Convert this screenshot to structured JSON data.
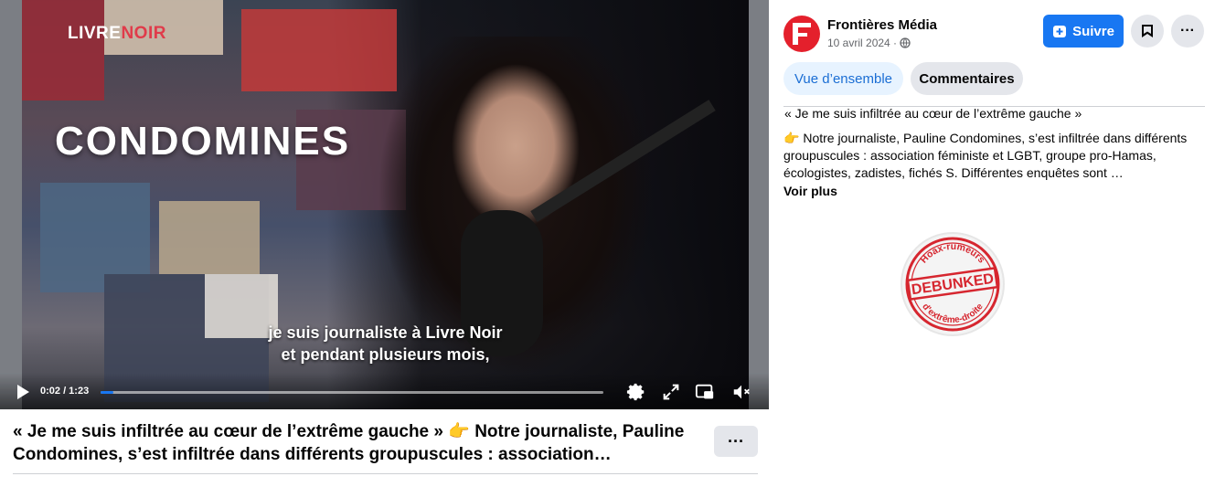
{
  "video": {
    "brand_left": "LIVRE",
    "brand_right": "NOIR",
    "overlay_name": "CONDOMINES",
    "subtitle_line1": "je suis journaliste à Livre Noir",
    "subtitle_line2": "et pendant plusieurs mois,",
    "time": "0:02 / 1:23",
    "progress_fraction": 0.025,
    "controls": {
      "play_icon": "play-icon",
      "settings_icon": "gear-icon",
      "fullscreen_icon": "expand-icon",
      "pip_icon": "picture-in-picture-icon",
      "volume_icon": "volume-muted-icon"
    }
  },
  "post": {
    "caption_start": "« Je me suis infiltrée au cœur de l’extrême gauche »",
    "caption_emoji": "👉",
    "caption_rest": " Notre journaliste, Pauline Condomines, s’est infiltrée dans différents groupuscules : association…",
    "more_label": "···"
  },
  "panel": {
    "page_name": "Frontières Média",
    "date": "10 avril 2024 ·",
    "privacy_icon": "globe-icon",
    "follow_label": "Suivre",
    "follow_icon": "follow-page-icon",
    "save_icon": "save-icon",
    "menu_label": "···",
    "tabs": [
      {
        "label": "Vue d’ensemble",
        "active": true
      },
      {
        "label": "Commentaires",
        "active": false
      }
    ],
    "description_title": "« Je me suis infiltrée au cœur de l’extrême gauche »",
    "description_emoji": "👉",
    "description_body": " Notre journaliste, Pauline Condomines, s’est infiltrée dans différents groupuscules : association féministe et LGBT, groupe pro-Hamas, écologistes, zadistes, fichés S. Différentes enquêtes sont …",
    "see_more": "Voir plus"
  },
  "stamp": {
    "top_text": "Hoax-rumeurs",
    "center_text": "DEBUNKED",
    "bottom_text": "d’extrême-droite"
  },
  "colors": {
    "facebook_blue": "#1877f2",
    "page_avatar_red": "#e4202c",
    "stamp_red": "#d6262f",
    "tab_active_bg": "#e7f3ff"
  }
}
